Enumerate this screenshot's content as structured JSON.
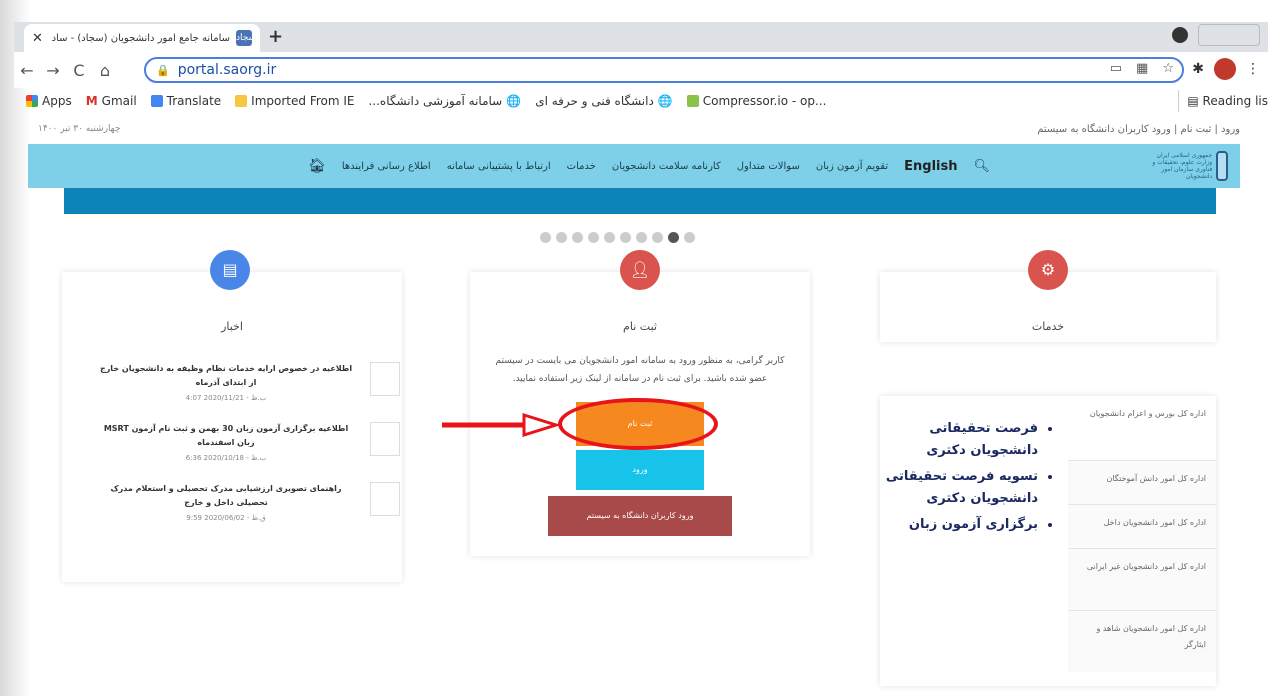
{
  "browser": {
    "tab_title": "سامانه جامع امور دانشجویان (سجاد) - ساد",
    "tab_favicon": "سجاد",
    "url": "portal.saorg.ir",
    "bookmarks": [
      "Apps",
      "Gmail",
      "Translate",
      "Imported From IE",
      "سامانه آموزشی دانشگاه...",
      "دانشگاه فنی و حرفه ای",
      "Compressor.io - op..."
    ],
    "reading_list": "Reading lis"
  },
  "page": {
    "date": "چهارشنبه ۳۰ تیر ۱۴۰۰",
    "top_links": "ورود | ثبت نام | ورود کاربران دانشگاه به سیستم",
    "logo_text": "جمهوری اسلامی ایران وزارت علوم، تحقیقات و فناوری سازمان امور دانشجویان",
    "menu": [
      "اطلاع رسانی فرایندها",
      "ارتباط با پشتیبانی سامانه",
      "خدمات",
      "کارنامه سلامت دانشجویان",
      "سوالات متداول",
      "تقویم آزمون زبان"
    ],
    "english": "English",
    "news": {
      "title": "اخبار",
      "items": [
        {
          "text": "اطلاعیه در خصوص ارایه خدمات نظام وظیفه به دانشجویان خارج از ابتدای آذرماه",
          "date": "4:07 ب.ظ - 2020/11/21"
        },
        {
          "text": "اطلاعیه برگزاری آزمون زبان 30 بهمن و ثبت نام آزمون MSRT زبان اسفندماه",
          "date": "6:36 ب.ظ - 2020/10/18"
        },
        {
          "text": "راهنمای تصویری ارزشیابی مدرک تحصیلی و استعلام مدرک تحصیلی داخل و خارج",
          "date": "9:59 ق.ظ - 2020/06/02"
        }
      ]
    },
    "register": {
      "title": "ثبت نام",
      "desc": "کاربر گرامی، به منظور ورود به سامانه امور دانشجویان می بایست در سیستم عضو شده باشید. برای ثبت نام در سامانه از لینک زیر استفاده نمایید.",
      "register_btn": "ثبت نام",
      "login_btn": "ورود",
      "uni_btn": "ورود کاربران دانشگاه به سیستم"
    },
    "services": {
      "title": "خدمات",
      "featured": [
        "فرصت تحقیقاتی دانشجویان دکتری",
        "تسویه فرصت تحقیقاتی دانشجویان دکتری",
        "برگزاری آزمون زبان"
      ],
      "departments": [
        "اداره کل بورس و اعزام دانشجویان",
        "اداره کل امور دانش آموختگان",
        "اداره کل امور دانشجویان داخل",
        "اداره کل امور دانشجویان غیر ایرانی",
        "اداره کل امور دانشجویان شاهد و ایثارگر"
      ]
    }
  },
  "colors": {
    "navbar": "#7ed0e8",
    "banner": "#0d84b8",
    "news_circle": "#4a86e8",
    "reg_circle": "#d9534f",
    "svc_circle": "#d9534f",
    "register_btn": "#f5881f",
    "login_btn": "#17c3e8",
    "uni_btn": "#a94a4a",
    "annotation": "#e8141a"
  }
}
